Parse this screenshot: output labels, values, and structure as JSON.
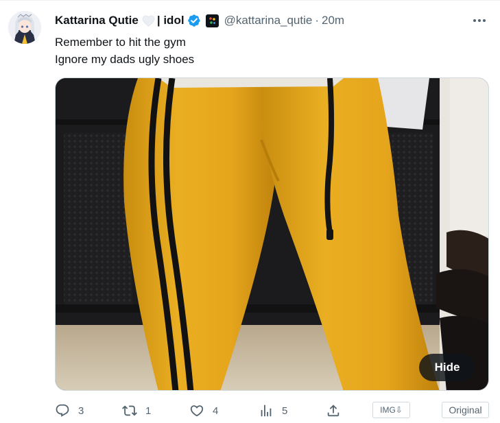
{
  "tweet": {
    "display_name": "Kattarina Qutie",
    "name_suffix": "| idol",
    "handle": "@kattarina_qutie",
    "separator": "·",
    "time": "20m",
    "text_lines": [
      "Remember to hit the gym",
      "Ignore my dads ugly shoes"
    ]
  },
  "media": {
    "hide_label": "Hide"
  },
  "actions": {
    "reply_count": "3",
    "retweet_count": "1",
    "like_count": "4",
    "views_count": "5",
    "img_download_label": "IMG⇩",
    "original_label": "Original"
  },
  "icons": {
    "avatar": "avatar-icon",
    "heart_emoji": "white-heart-icon",
    "verified": "verified-badge-icon",
    "affiliate": "affiliate-logo-icon",
    "more": "more-icon",
    "reply": "reply-icon",
    "retweet": "retweet-icon",
    "like": "like-icon",
    "views": "views-icon",
    "share": "share-icon"
  },
  "colors": {
    "accent": "#1d9bf0",
    "text": "#0f1419",
    "muted": "#536471",
    "pants_yellow": "#e8a91d"
  }
}
